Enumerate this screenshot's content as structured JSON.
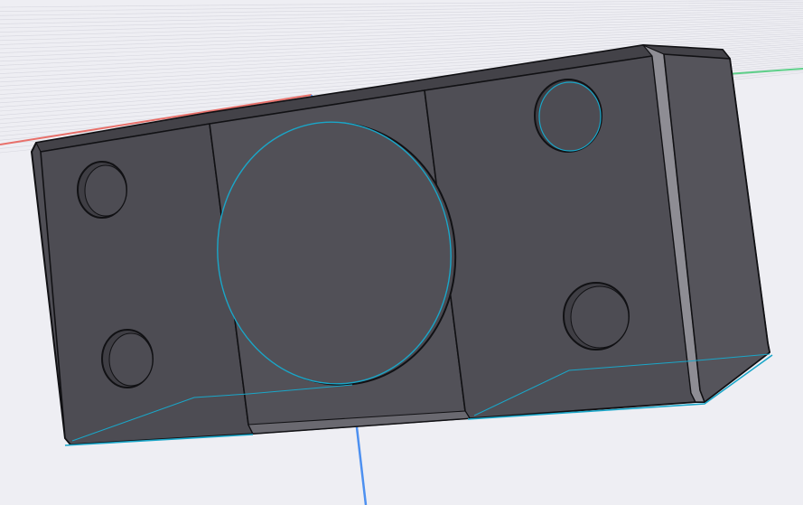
{
  "viewport": {
    "name": "3d-cad-viewport",
    "background_color": "#eeeef3",
    "grid_line_color": "#d6d6de",
    "axis_colors": {
      "x": "#e8706a",
      "y": "#5fd08a",
      "z": "#4d90f0"
    }
  },
  "part": {
    "name": "rectangular-block-with-holes",
    "face_color": "#4f4e55",
    "face_light_color": "#5a5960",
    "fillet_color": "#8e8d94",
    "edge_color": "#111114",
    "selection_edge_color": "#1aa6c8",
    "regions": [
      "left-pad",
      "center-recess",
      "right-pad",
      "right-chamfer"
    ],
    "mounting_hole_count": 4,
    "center_bore_count": 1
  }
}
